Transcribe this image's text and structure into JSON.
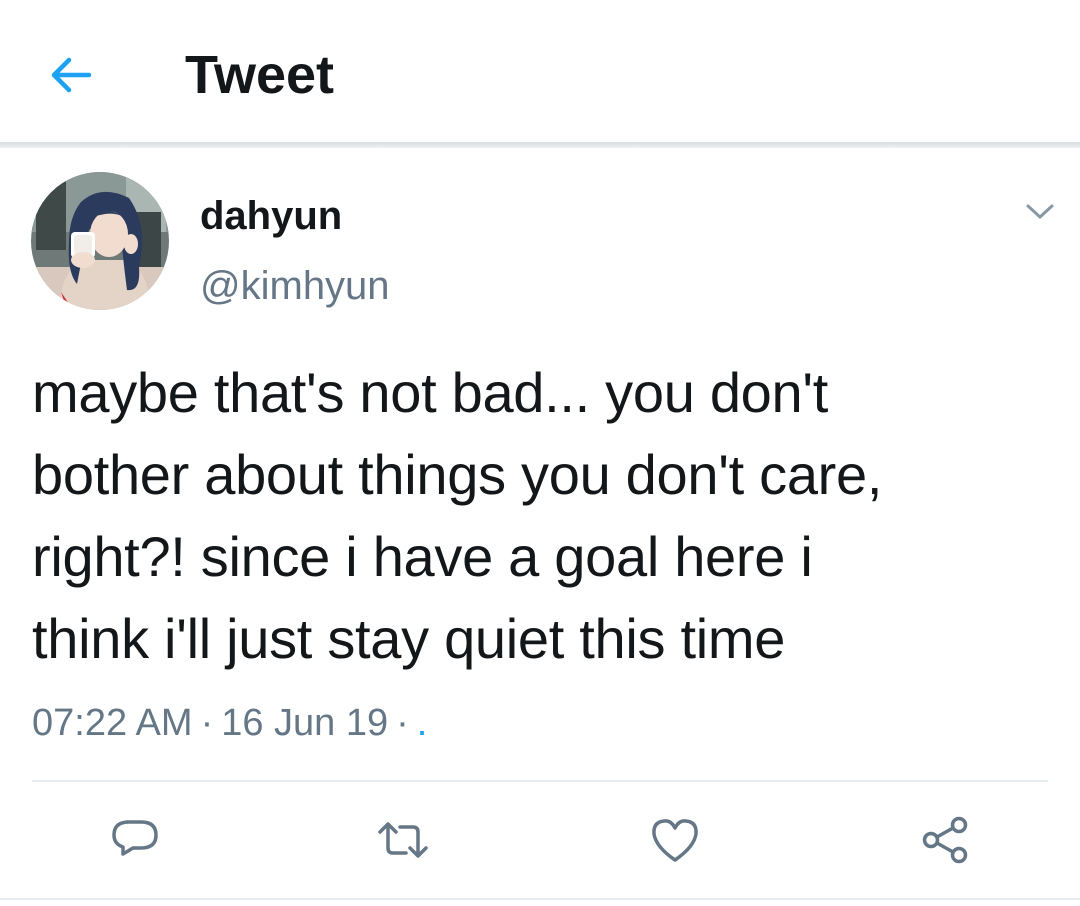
{
  "header": {
    "title": "Tweet",
    "back_icon": "arrow-left-icon"
  },
  "author": {
    "display_name": "dahyun",
    "username": "@kimhyun",
    "avatar": "avatar-photo",
    "menu_icon": "chevron-down-icon"
  },
  "tweet": {
    "lines": [
      "maybe that's not bad... you don't",
      "bother about things you don't care,",
      "right?! since i have a goal here i",
      "think i'll just stay quiet this time"
    ],
    "time": "07:22 AM",
    "separator": "·",
    "date": "16 Jun 19",
    "source": "."
  },
  "actions": [
    {
      "name": "reply",
      "icon": "reply-icon"
    },
    {
      "name": "retweet",
      "icon": "retweet-icon"
    },
    {
      "name": "like",
      "icon": "heart-icon"
    },
    {
      "name": "share",
      "icon": "share-icon"
    }
  ],
  "colors": {
    "accent": "#1da1f2",
    "text": "#14171a",
    "secondary_text": "#657786",
    "icon": "#657786"
  }
}
